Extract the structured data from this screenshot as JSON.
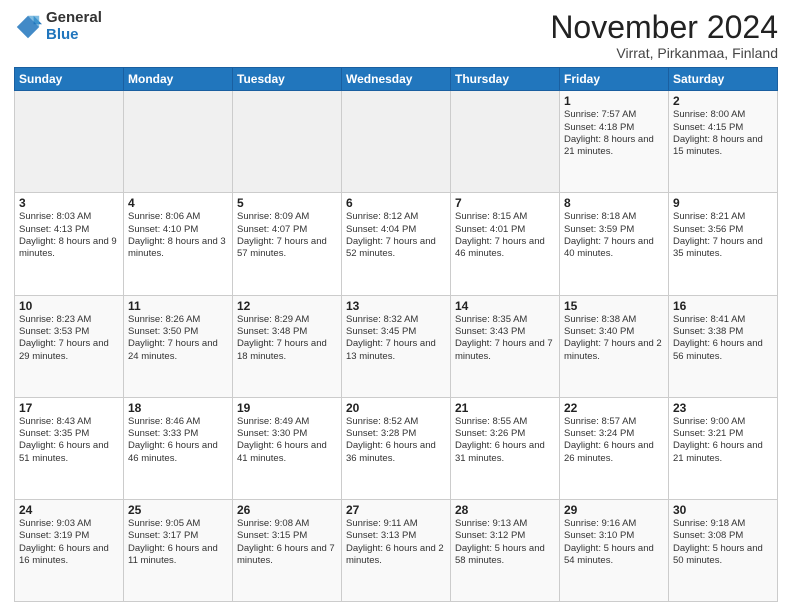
{
  "logo": {
    "general": "General",
    "blue": "Blue"
  },
  "header": {
    "month": "November 2024",
    "location": "Virrat, Pirkanmaa, Finland"
  },
  "days_of_week": [
    "Sunday",
    "Monday",
    "Tuesday",
    "Wednesday",
    "Thursday",
    "Friday",
    "Saturday"
  ],
  "weeks": [
    [
      {
        "day": "",
        "info": ""
      },
      {
        "day": "",
        "info": ""
      },
      {
        "day": "",
        "info": ""
      },
      {
        "day": "",
        "info": ""
      },
      {
        "day": "",
        "info": ""
      },
      {
        "day": "1",
        "info": "Sunrise: 7:57 AM\nSunset: 4:18 PM\nDaylight: 8 hours and 21 minutes."
      },
      {
        "day": "2",
        "info": "Sunrise: 8:00 AM\nSunset: 4:15 PM\nDaylight: 8 hours and 15 minutes."
      }
    ],
    [
      {
        "day": "3",
        "info": "Sunrise: 8:03 AM\nSunset: 4:13 PM\nDaylight: 8 hours and 9 minutes."
      },
      {
        "day": "4",
        "info": "Sunrise: 8:06 AM\nSunset: 4:10 PM\nDaylight: 8 hours and 3 minutes."
      },
      {
        "day": "5",
        "info": "Sunrise: 8:09 AM\nSunset: 4:07 PM\nDaylight: 7 hours and 57 minutes."
      },
      {
        "day": "6",
        "info": "Sunrise: 8:12 AM\nSunset: 4:04 PM\nDaylight: 7 hours and 52 minutes."
      },
      {
        "day": "7",
        "info": "Sunrise: 8:15 AM\nSunset: 4:01 PM\nDaylight: 7 hours and 46 minutes."
      },
      {
        "day": "8",
        "info": "Sunrise: 8:18 AM\nSunset: 3:59 PM\nDaylight: 7 hours and 40 minutes."
      },
      {
        "day": "9",
        "info": "Sunrise: 8:21 AM\nSunset: 3:56 PM\nDaylight: 7 hours and 35 minutes."
      }
    ],
    [
      {
        "day": "10",
        "info": "Sunrise: 8:23 AM\nSunset: 3:53 PM\nDaylight: 7 hours and 29 minutes."
      },
      {
        "day": "11",
        "info": "Sunrise: 8:26 AM\nSunset: 3:50 PM\nDaylight: 7 hours and 24 minutes."
      },
      {
        "day": "12",
        "info": "Sunrise: 8:29 AM\nSunset: 3:48 PM\nDaylight: 7 hours and 18 minutes."
      },
      {
        "day": "13",
        "info": "Sunrise: 8:32 AM\nSunset: 3:45 PM\nDaylight: 7 hours and 13 minutes."
      },
      {
        "day": "14",
        "info": "Sunrise: 8:35 AM\nSunset: 3:43 PM\nDaylight: 7 hours and 7 minutes."
      },
      {
        "day": "15",
        "info": "Sunrise: 8:38 AM\nSunset: 3:40 PM\nDaylight: 7 hours and 2 minutes."
      },
      {
        "day": "16",
        "info": "Sunrise: 8:41 AM\nSunset: 3:38 PM\nDaylight: 6 hours and 56 minutes."
      }
    ],
    [
      {
        "day": "17",
        "info": "Sunrise: 8:43 AM\nSunset: 3:35 PM\nDaylight: 6 hours and 51 minutes."
      },
      {
        "day": "18",
        "info": "Sunrise: 8:46 AM\nSunset: 3:33 PM\nDaylight: 6 hours and 46 minutes."
      },
      {
        "day": "19",
        "info": "Sunrise: 8:49 AM\nSunset: 3:30 PM\nDaylight: 6 hours and 41 minutes."
      },
      {
        "day": "20",
        "info": "Sunrise: 8:52 AM\nSunset: 3:28 PM\nDaylight: 6 hours and 36 minutes."
      },
      {
        "day": "21",
        "info": "Sunrise: 8:55 AM\nSunset: 3:26 PM\nDaylight: 6 hours and 31 minutes."
      },
      {
        "day": "22",
        "info": "Sunrise: 8:57 AM\nSunset: 3:24 PM\nDaylight: 6 hours and 26 minutes."
      },
      {
        "day": "23",
        "info": "Sunrise: 9:00 AM\nSunset: 3:21 PM\nDaylight: 6 hours and 21 minutes."
      }
    ],
    [
      {
        "day": "24",
        "info": "Sunrise: 9:03 AM\nSunset: 3:19 PM\nDaylight: 6 hours and 16 minutes."
      },
      {
        "day": "25",
        "info": "Sunrise: 9:05 AM\nSunset: 3:17 PM\nDaylight: 6 hours and 11 minutes."
      },
      {
        "day": "26",
        "info": "Sunrise: 9:08 AM\nSunset: 3:15 PM\nDaylight: 6 hours and 7 minutes."
      },
      {
        "day": "27",
        "info": "Sunrise: 9:11 AM\nSunset: 3:13 PM\nDaylight: 6 hours and 2 minutes."
      },
      {
        "day": "28",
        "info": "Sunrise: 9:13 AM\nSunset: 3:12 PM\nDaylight: 5 hours and 58 minutes."
      },
      {
        "day": "29",
        "info": "Sunrise: 9:16 AM\nSunset: 3:10 PM\nDaylight: 5 hours and 54 minutes."
      },
      {
        "day": "30",
        "info": "Sunrise: 9:18 AM\nSunset: 3:08 PM\nDaylight: 5 hours and 50 minutes."
      }
    ]
  ]
}
